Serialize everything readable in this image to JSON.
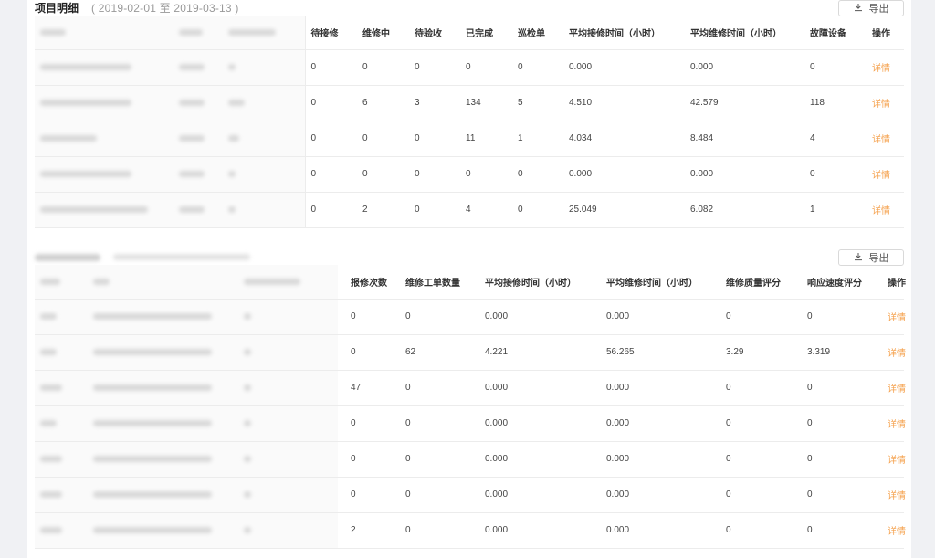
{
  "section1": {
    "title": "项目明细",
    "date_range": "( 2019-02-01 至 2019-03-13 )",
    "export_label": "导出",
    "columns": [
      "待接修",
      "维修中",
      "待验收",
      "已完成",
      "巡检单",
      "平均接修时间（小时）",
      "平均维修时间（小时）",
      "故障设备",
      "操作"
    ],
    "rows": [
      [
        "0",
        "0",
        "0",
        "0",
        "0",
        "0.000",
        "0.000",
        "0",
        "详情"
      ],
      [
        "0",
        "6",
        "3",
        "134",
        "5",
        "4.510",
        "42.579",
        "118",
        "详情"
      ],
      [
        "0",
        "0",
        "0",
        "11",
        "1",
        "4.034",
        "8.484",
        "4",
        "详情"
      ],
      [
        "0",
        "0",
        "0",
        "0",
        "0",
        "0.000",
        "0.000",
        "0",
        "详情"
      ],
      [
        "0",
        "2",
        "0",
        "4",
        "0",
        "25.049",
        "6.082",
        "1",
        "详情"
      ]
    ]
  },
  "section2": {
    "export_label": "导出",
    "columns": [
      "报修次数",
      "维修工单数量",
      "平均接修时间（小时）",
      "平均维修时间（小时）",
      "维修质量评分",
      "响应速度评分",
      "操作"
    ],
    "rows": [
      [
        "0",
        "0",
        "0.000",
        "0.000",
        "0",
        "0",
        "详情"
      ],
      [
        "0",
        "62",
        "4.221",
        "56.265",
        "3.29",
        "3.319",
        "详情"
      ],
      [
        "47",
        "0",
        "0.000",
        "0.000",
        "0",
        "0",
        "详情"
      ],
      [
        "0",
        "0",
        "0.000",
        "0.000",
        "0",
        "0",
        "详情"
      ],
      [
        "0",
        "0",
        "0.000",
        "0.000",
        "0",
        "0",
        "详情"
      ],
      [
        "0",
        "0",
        "0.000",
        "0.000",
        "0",
        "0",
        "详情"
      ],
      [
        "2",
        "0",
        "0.000",
        "0.000",
        "0",
        "0",
        "详情"
      ]
    ]
  },
  "colors": {
    "link": "#f5a04b",
    "background": "#f0f1f4",
    "border": "#ececec"
  },
  "icons": {
    "export": "download-icon"
  }
}
